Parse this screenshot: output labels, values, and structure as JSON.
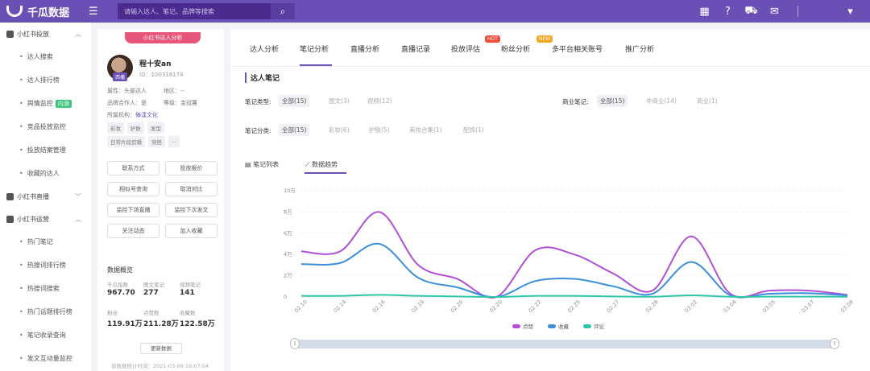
{
  "header": {
    "logo_text": "千瓜数据",
    "search_placeholder": "请输入达人、笔记、品牌等搜索",
    "icons": [
      "grid-icon",
      "help-icon",
      "cart-icon",
      "mail-icon",
      "chevron-down-icon"
    ],
    "accent": "#6a4fb5"
  },
  "sidebar": {
    "sections": [
      {
        "label": "小红书投放",
        "items": [
          "达人搜索",
          "达人排行榜",
          "舆情监控",
          "竞品投放监控",
          "投放结案管理",
          "收藏的达人"
        ]
      },
      {
        "label": "小红书直播",
        "items": []
      },
      {
        "label": "小红书运营",
        "items": [
          "热门笔记",
          "热搜词排行榜",
          "热搜词搜索",
          "热门话题排行榜",
          "笔记收录查询",
          "发文互动量监控"
        ]
      }
    ],
    "new_tag": "内测"
  },
  "profile": {
    "badge": "小红书达人分析",
    "avatar_tag": "西播",
    "name": "程十安an",
    "id": "ID：100318174",
    "attr_label": "属性：头部达人",
    "region_label": "地区：--",
    "brand_coop": "品牌合作人：是",
    "level": "等级：金冠薯",
    "agency_label": "所属机构：",
    "agency_value": "傣漾文化",
    "tags_row1": [
      "彩妆",
      "护肤",
      "发型"
    ],
    "tags_row2": [
      "日常片段剪辑",
      "穿搭",
      "..."
    ],
    "buttons": [
      "联系方式",
      "投放报价",
      "相似号查询",
      "取消对比",
      "监控下场直播",
      "监控下次发文",
      "关注动态",
      "加入收藏"
    ],
    "overview_title": "数据概览",
    "stats": [
      {
        "label": "千瓜指数",
        "value": "967.70"
      },
      {
        "label": "图文笔记",
        "value": "277"
      },
      {
        "label": "视频笔记",
        "value": "141"
      },
      {
        "label": "粉丝",
        "value": "119.91万"
      },
      {
        "label": "点赞数",
        "value": "211.28万"
      },
      {
        "label": "收藏数",
        "value": "122.58万"
      }
    ],
    "refresh": "更新数据",
    "updated": "该数据统计时间：2021-03-09 16:07:04"
  },
  "main": {
    "tabs": [
      "达人分析",
      "笔记分析",
      "直播分析",
      "直播记录",
      "投放评估",
      "粉丝分析",
      "多平台相关账号",
      "推广分析"
    ],
    "hot_badge": "HOT",
    "new_badge": "NEW",
    "section_title": "达人笔记",
    "filter_type_label": "笔记类型:",
    "filter_type_opts": [
      "全部(15)",
      "图文(3)",
      "视频(12)"
    ],
    "filter_biz_label": "商业笔记:",
    "filter_biz_opts": [
      "全部(15)",
      "非商业(14)",
      "商业(1)"
    ],
    "filter_cat_label": "笔记分类:",
    "filter_cat_opts": [
      "全部(15)",
      "彩妆(6)",
      "护肤(5)",
      "美妆合集(1)",
      "配饰(1)"
    ],
    "subtab_list": "笔记列表",
    "subtab_trend": "数据趋势"
  },
  "chart_data": {
    "type": "line",
    "x": [
      "02.10",
      "02.14",
      "02.16",
      "02.19",
      "02.20",
      "02.20",
      "02.22",
      "02.25",
      "02.27",
      "02.28",
      "03.02",
      "03.04",
      "03.05",
      "03.07",
      "03.08"
    ],
    "y_ticks": [
      "0",
      "2万",
      "4万",
      "6万",
      "8万",
      "10万"
    ],
    "ylim": [
      0,
      100000
    ],
    "series": [
      {
        "name": "点赞",
        "color": "#b14fd6",
        "values": [
          43000,
          43000,
          80000,
          30000,
          17000,
          0,
          44000,
          40000,
          22000,
          6000,
          57000,
          3000,
          6000,
          6000,
          2000
        ]
      },
      {
        "name": "收藏",
        "color": "#3b8fd9",
        "values": [
          31000,
          32000,
          50000,
          18000,
          9000,
          0,
          15000,
          17000,
          10000,
          3000,
          33000,
          1500,
          3000,
          3500,
          1500
        ]
      },
      {
        "name": "评论",
        "color": "#2ec7a6",
        "values": [
          1000,
          1000,
          2000,
          1000,
          500,
          0,
          1000,
          1000,
          500,
          200,
          1500,
          200,
          300,
          300,
          200
        ]
      }
    ],
    "legend": "bottom"
  }
}
